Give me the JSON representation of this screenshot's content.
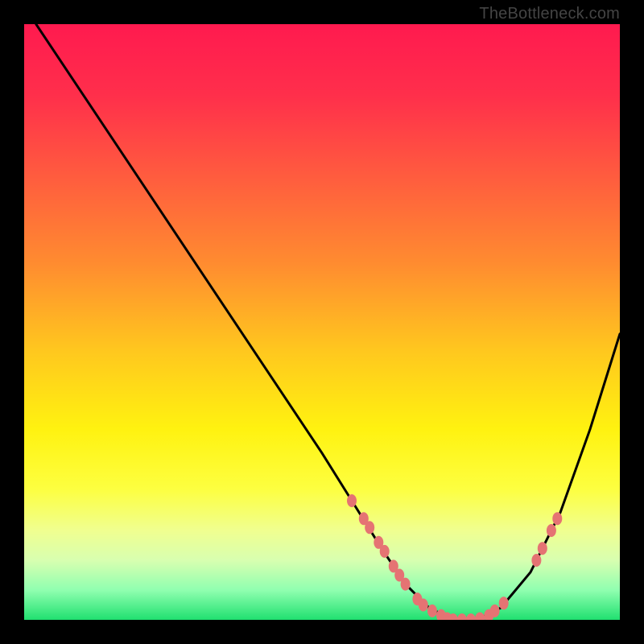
{
  "watermark": "TheBottleneck.com",
  "gradient_stops": [
    {
      "offset": 0.0,
      "color": "#ff1a4f"
    },
    {
      "offset": 0.12,
      "color": "#ff2f4b"
    },
    {
      "offset": 0.25,
      "color": "#ff5a3f"
    },
    {
      "offset": 0.4,
      "color": "#ff8b30"
    },
    {
      "offset": 0.55,
      "color": "#ffc81e"
    },
    {
      "offset": 0.68,
      "color": "#fff210"
    },
    {
      "offset": 0.78,
      "color": "#fdff40"
    },
    {
      "offset": 0.85,
      "color": "#f0ff90"
    },
    {
      "offset": 0.9,
      "color": "#d8ffb0"
    },
    {
      "offset": 0.95,
      "color": "#90ffb0"
    },
    {
      "offset": 1.0,
      "color": "#20e070"
    }
  ],
  "chart_data": {
    "type": "line",
    "title": "",
    "xlabel": "",
    "ylabel": "",
    "xlim": [
      0,
      100
    ],
    "ylim": [
      0,
      100
    ],
    "series": [
      {
        "name": "bottleneck-curve",
        "x": [
          2,
          10,
          20,
          30,
          40,
          50,
          55,
          60,
          64,
          68,
          72,
          76,
          80,
          85,
          90,
          95,
          100
        ],
        "y": [
          100,
          88,
          73,
          58,
          43,
          28,
          20,
          12,
          6,
          2,
          0,
          0,
          2,
          8,
          18,
          32,
          48
        ]
      }
    ],
    "scatter": {
      "name": "highlight-points",
      "color": "#e57373",
      "points": [
        {
          "x": 55,
          "y": 20
        },
        {
          "x": 57,
          "y": 17
        },
        {
          "x": 58,
          "y": 15.5
        },
        {
          "x": 59.5,
          "y": 13
        },
        {
          "x": 60.5,
          "y": 11.5
        },
        {
          "x": 62,
          "y": 9
        },
        {
          "x": 63,
          "y": 7.5
        },
        {
          "x": 64,
          "y": 6
        },
        {
          "x": 66,
          "y": 3.5
        },
        {
          "x": 67,
          "y": 2.5
        },
        {
          "x": 68.5,
          "y": 1.5
        },
        {
          "x": 70,
          "y": 0.7
        },
        {
          "x": 71,
          "y": 0.2
        },
        {
          "x": 72,
          "y": 0
        },
        {
          "x": 73.5,
          "y": 0
        },
        {
          "x": 75,
          "y": 0
        },
        {
          "x": 76.5,
          "y": 0.2
        },
        {
          "x": 78,
          "y": 0.7
        },
        {
          "x": 79,
          "y": 1.5
        },
        {
          "x": 80.5,
          "y": 2.8
        },
        {
          "x": 86,
          "y": 10
        },
        {
          "x": 87,
          "y": 12
        },
        {
          "x": 88.5,
          "y": 15
        },
        {
          "x": 89.5,
          "y": 17
        }
      ]
    }
  }
}
